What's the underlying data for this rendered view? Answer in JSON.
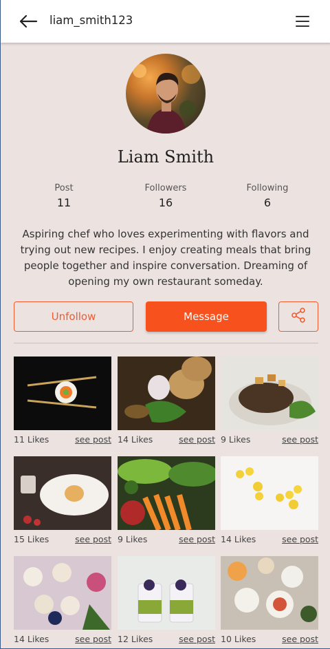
{
  "header": {
    "username": "liam_smith123",
    "back_icon": "arrow-left-icon",
    "menu_icon": "hamburger-menu-icon"
  },
  "profile": {
    "name": "Liam Smith",
    "stats": [
      {
        "label": "Post",
        "value": "11"
      },
      {
        "label": "Followers",
        "value": "16"
      },
      {
        "label": "Following",
        "value": "6"
      }
    ],
    "bio": "Aspiring chef who loves experimenting with flavors and trying out new recipes. I enjoy creating meals that bring people together and inspire conversation. Dreaming of opening my own restaurant someday."
  },
  "actions": {
    "unfollow": "Unfollow",
    "message": "Message",
    "share_icon": "share-icon"
  },
  "posts": [
    {
      "likes": "11 Likes",
      "link": "see post"
    },
    {
      "likes": "14 Likes",
      "link": "see post"
    },
    {
      "likes": "9 Likes",
      "link": "see post"
    },
    {
      "likes": "15 Likes",
      "link": "see post"
    },
    {
      "likes": "9 Likes",
      "link": "see post"
    },
    {
      "likes": "14 Likes",
      "link": "see post"
    },
    {
      "likes": "14 Likes",
      "link": "see post"
    },
    {
      "likes": "12 Likes",
      "link": "see post"
    },
    {
      "likes": "10 Likes",
      "link": "see post"
    }
  ],
  "colors": {
    "accent": "#f7521d",
    "background": "#ece3e1"
  }
}
